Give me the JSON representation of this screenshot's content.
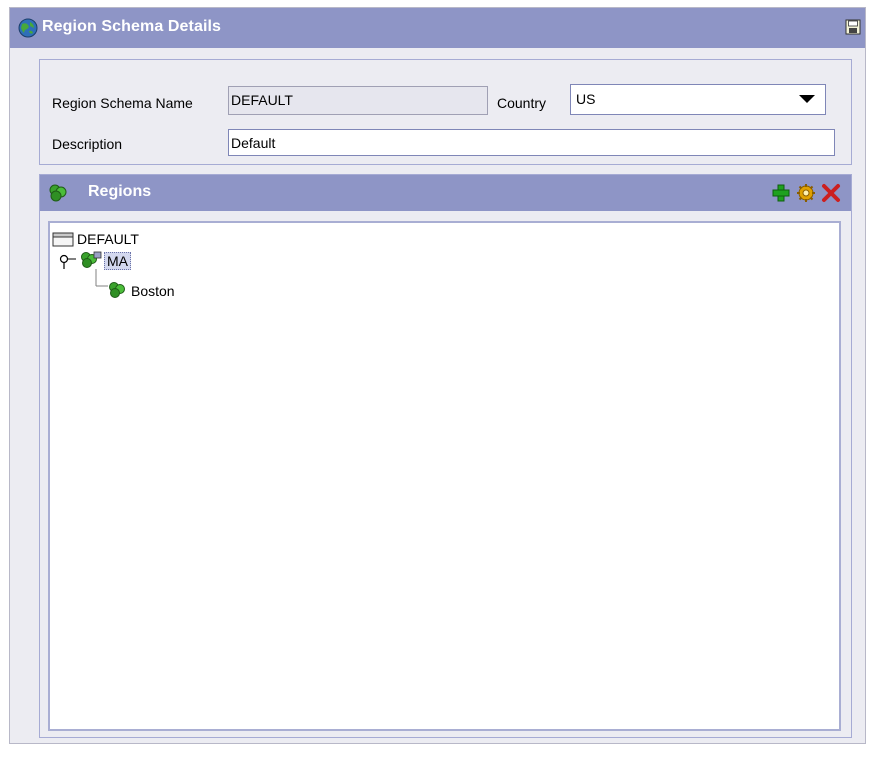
{
  "window": {
    "title": "Region Schema Details",
    "title_icon": "globe-icon",
    "save_icon": "save-icon"
  },
  "details": {
    "name_label": "Region Schema Name",
    "name_value": "DEFAULT",
    "country_label": "Country",
    "country_value": "US",
    "description_label": "Description",
    "description_value": "Default"
  },
  "regions": {
    "title": "Regions",
    "header_icon": "region-icon",
    "actions": [
      {
        "name": "add",
        "icon": "plus-icon",
        "color": "#1ea21e"
      },
      {
        "name": "details",
        "icon": "gear-icon",
        "color": "#e0a100"
      },
      {
        "name": "delete",
        "icon": "delete-x-icon",
        "color": "#cc1f1f"
      }
    ],
    "tree": {
      "root": "DEFAULT",
      "children": [
        {
          "label": "MA",
          "selected": true,
          "children": [
            {
              "label": "Boston"
            }
          ]
        }
      ]
    }
  },
  "colors": {
    "title_bar": "#8e95c6",
    "panel_border": "#a6abd4",
    "background": "#ececf2"
  }
}
